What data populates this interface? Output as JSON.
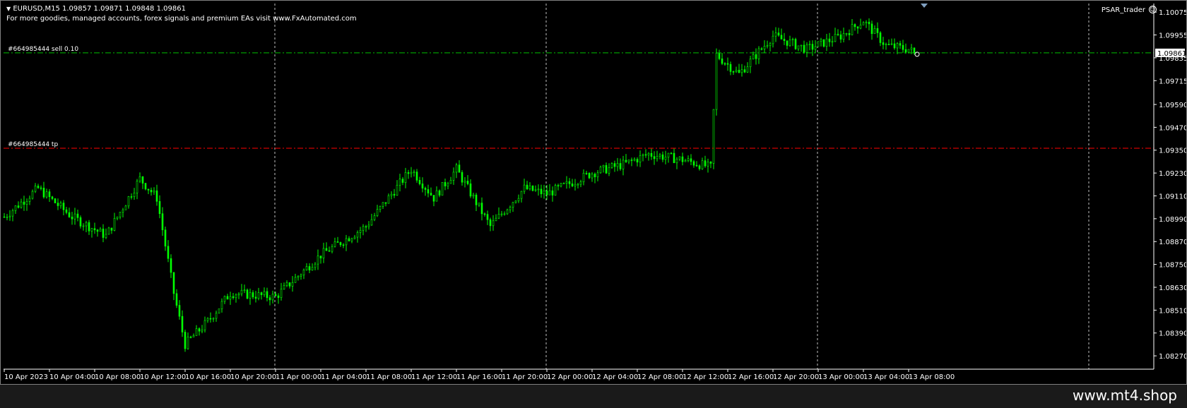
{
  "header": {
    "symbol_info": "EURUSD,M15  1.09857 1.09871 1.09848 1.09861",
    "promo": "For more goodies, managed accounts, forex signals and premium EAs visit www.FxAutomated.com",
    "ea_name": "PSAR_trader",
    "ea_icon": "smiley-icon"
  },
  "watermark": "www.mt4.shop",
  "colors": {
    "background": "#000000",
    "bull": "#00ff00",
    "bear": "#00ff00",
    "grid": "#c0c0c0",
    "sell_line": "#00c000",
    "tp_line": "#ff0000",
    "text": "#ffffff"
  },
  "chart_data": {
    "type": "candlestick",
    "symbol": "EURUSD",
    "timeframe": "M15",
    "ylim": [
      1.082,
      1.1012
    ],
    "y_ticks": [
      "1.10075",
      "1.09955",
      "1.09835",
      "1.09715",
      "1.09590",
      "1.09470",
      "1.09350",
      "1.09230",
      "1.09110",
      "1.08990",
      "1.08870",
      "1.08750",
      "1.08630",
      "1.08510",
      "1.08390",
      "1.08270"
    ],
    "y_tick_values": [
      1.10075,
      1.09955,
      1.09835,
      1.09715,
      1.0959,
      1.0947,
      1.0935,
      1.0923,
      1.0911,
      1.0899,
      1.0887,
      1.0875,
      1.0863,
      1.0851,
      1.0839,
      1.0827
    ],
    "x_ticks": [
      "10 Apr 2023",
      "10 Apr 04:00",
      "10 Apr 08:00",
      "10 Apr 12:00",
      "10 Apr 16:00",
      "10 Apr 20:00",
      "11 Apr 00:00",
      "11 Apr 04:00",
      "11 Apr 08:00",
      "11 Apr 12:00",
      "11 Apr 16:00",
      "11 Apr 20:00",
      "12 Apr 00:00",
      "12 Apr 04:00",
      "12 Apr 08:00",
      "12 Apr 12:00",
      "12 Apr 16:00",
      "12 Apr 20:00",
      "13 Apr 00:00",
      "13 Apr 04:00",
      "13 Apr 08:00"
    ],
    "current_price": "1.09861",
    "current_price_value": 1.09861,
    "order_lines": [
      {
        "label": "#664985444 sell 0.10",
        "price": 1.09861,
        "style": "dash-dot",
        "color": "#00c000"
      },
      {
        "label": "#664985444 tp",
        "price": 1.0936,
        "style": "dash-dot",
        "color": "#ff0000"
      }
    ],
    "key_prices": [
      {
        "time": "10 Apr 2023",
        "price": 1.09
      },
      {
        "time": "10 Apr 03:00",
        "price": 1.0915
      },
      {
        "time": "10 Apr 06:00",
        "price": 1.09
      },
      {
        "time": "10 Apr 09:00",
        "price": 1.089
      },
      {
        "time": "10 Apr 12:00",
        "price": 1.092
      },
      {
        "time": "10 Apr 13:30",
        "price": 1.091
      },
      {
        "time": "10 Apr 15:00",
        "price": 1.086
      },
      {
        "time": "10 Apr 16:00",
        "price": 1.0833
      },
      {
        "time": "10 Apr 18:00",
        "price": 1.0845
      },
      {
        "time": "10 Apr 20:00",
        "price": 1.086
      },
      {
        "time": "11 Apr 00:00",
        "price": 1.0858
      },
      {
        "time": "11 Apr 04:00",
        "price": 1.088
      },
      {
        "time": "11 Apr 08:00",
        "price": 1.0895
      },
      {
        "time": "11 Apr 12:00",
        "price": 1.0925
      },
      {
        "time": "11 Apr 14:00",
        "price": 1.091
      },
      {
        "time": "11 Apr 16:00",
        "price": 1.0925
      },
      {
        "time": "11 Apr 19:00",
        "price": 1.0895
      },
      {
        "time": "11 Apr 22:00",
        "price": 1.0915
      },
      {
        "time": "12 Apr 00:00",
        "price": 1.0912
      },
      {
        "time": "12 Apr 04:00",
        "price": 1.0923
      },
      {
        "time": "12 Apr 07:00",
        "price": 1.0928
      },
      {
        "time": "12 Apr 09:00",
        "price": 1.0933
      },
      {
        "time": "12 Apr 12:00",
        "price": 1.093
      },
      {
        "time": "12 Apr 14:30",
        "price": 1.0926
      },
      {
        "time": "12 Apr 15:00",
        "price": 1.0985
      },
      {
        "time": "12 Apr 17:00",
        "price": 1.0975
      },
      {
        "time": "12 Apr 20:00",
        "price": 1.0995
      },
      {
        "time": "12 Apr 23:00",
        "price": 1.0988
      },
      {
        "time": "13 Apr 02:00",
        "price": 1.0995
      },
      {
        "time": "13 Apr 04:00",
        "price": 1.1003
      },
      {
        "time": "13 Apr 06:00",
        "price": 1.099
      },
      {
        "time": "13 Apr 08:00",
        "price": 1.0988
      },
      {
        "time": "13 Apr 08:30",
        "price": 1.09861
      }
    ]
  }
}
